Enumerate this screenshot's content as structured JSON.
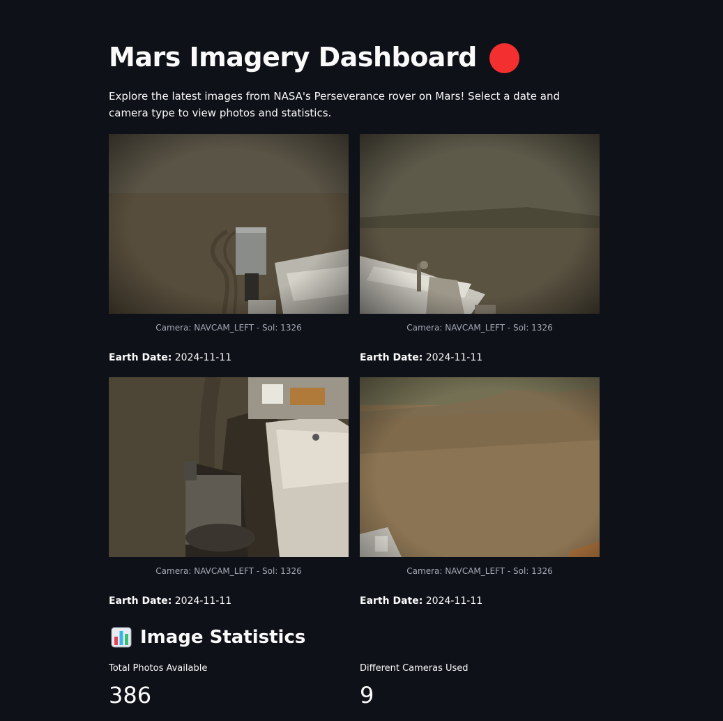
{
  "page": {
    "title": "Mars Imagery Dashboard",
    "intro": "Explore the latest images from NASA's Perseverance rover on Mars! Select a date and camera type to view photos and statistics."
  },
  "photos": [
    {
      "caption": "Camera: NAVCAM_LEFT - Sol: 1326",
      "earth_date_label": "Earth Date:",
      "earth_date": "2024-11-11"
    },
    {
      "caption": "Camera: NAVCAM_LEFT - Sol: 1326",
      "earth_date_label": "Earth Date:",
      "earth_date": "2024-11-11"
    },
    {
      "caption": "Camera: NAVCAM_LEFT - Sol: 1326",
      "earth_date_label": "Earth Date:",
      "earth_date": "2024-11-11"
    },
    {
      "caption": "Camera: NAVCAM_LEFT - Sol: 1326",
      "earth_date_label": "Earth Date:",
      "earth_date": "2024-11-11"
    }
  ],
  "stats": {
    "heading": "Image Statistics",
    "icon": "bar-chart-icon",
    "metrics": [
      {
        "label": "Total Photos Available",
        "value": "386"
      },
      {
        "label": "Different Cameras Used",
        "value": "9"
      }
    ]
  },
  "colors": {
    "background": "#0e1117",
    "text": "#fafafa",
    "caption": "#a3a8b4",
    "status_dot": "#f42f2f"
  }
}
